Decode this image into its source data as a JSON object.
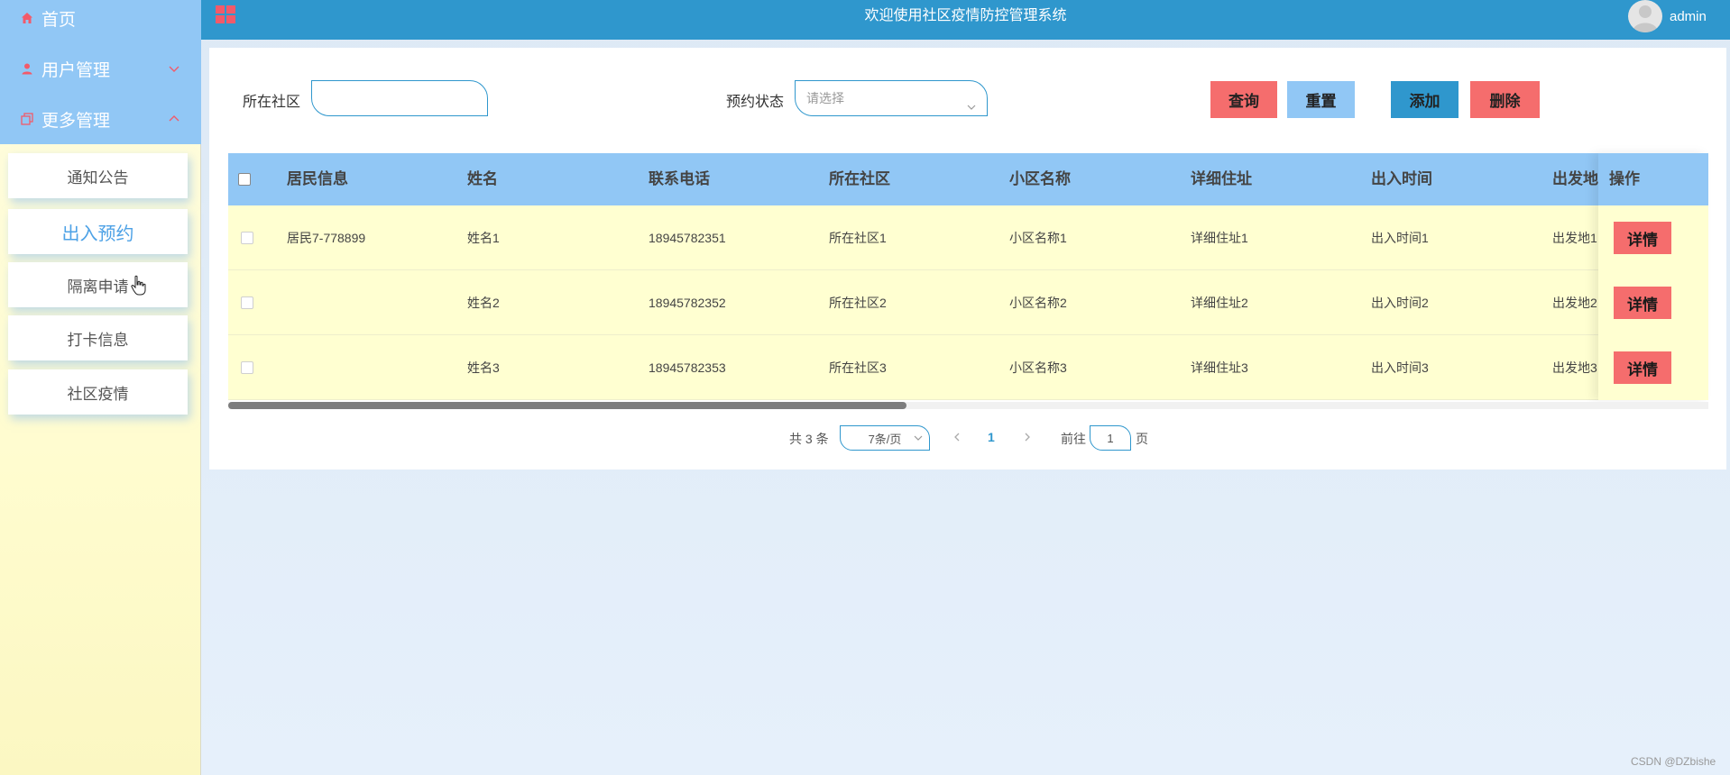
{
  "header": {
    "title": "欢迎使用社区疫情防控管理系统",
    "username": "admin"
  },
  "sidebar": {
    "items": [
      {
        "label": "首页"
      },
      {
        "label": "用户管理"
      },
      {
        "label": "更多管理"
      }
    ],
    "subitems": [
      {
        "label": "通知公告"
      },
      {
        "label": "出入预约"
      },
      {
        "label": "隔离申请"
      },
      {
        "label": "打卡信息"
      },
      {
        "label": "社区疫情"
      }
    ]
  },
  "filters": {
    "community_label": "所在社区",
    "community_value": "",
    "status_label": "预约状态",
    "status_placeholder": "请选择"
  },
  "buttons": {
    "query": "查询",
    "reset": "重置",
    "add": "添加",
    "delete": "删除"
  },
  "table": {
    "columns": [
      "居民信息",
      "姓名",
      "联系电话",
      "所在社区",
      "小区名称",
      "详细住址",
      "出入时间",
      "出发地",
      "操作"
    ],
    "rows": [
      {
        "resident": "居民7-778899",
        "name": "姓名1",
        "phone": "18945782351",
        "community": "所在社区1",
        "estate": "小区名称1",
        "address": "详细住址1",
        "time": "出入时间1",
        "origin": "出发地1",
        "action": "详情"
      },
      {
        "resident": "",
        "name": "姓名2",
        "phone": "18945782352",
        "community": "所在社区2",
        "estate": "小区名称2",
        "address": "详细住址2",
        "time": "出入时间2",
        "origin": "出发地2",
        "action": "详情"
      },
      {
        "resident": "",
        "name": "姓名3",
        "phone": "18945782353",
        "community": "所在社区3",
        "estate": "小区名称3",
        "address": "详细住址3",
        "time": "出入时间3",
        "origin": "出发地3",
        "action": "详情"
      }
    ]
  },
  "pagination": {
    "total": "共 3 条",
    "page_size": "7条/页",
    "current_page": "1",
    "goto_label": "前往",
    "goto_value": "1",
    "page_suffix": "页"
  },
  "watermark": "CSDN @DZbishe",
  "colors": {
    "topbar": "#2f97cd",
    "sidebar_top": "#91c7f5",
    "table_header": "#91c7f5",
    "row_bg": "#ffffd1",
    "danger": "#f56d6d",
    "accent": "#4ea2e6"
  },
  "icons": [
    "home-icon",
    "user-icon",
    "copy-icon",
    "chevron-down-icon",
    "chevron-up-icon",
    "grid-menu-icon",
    "avatar-icon",
    "pointer-cursor-icon"
  ]
}
